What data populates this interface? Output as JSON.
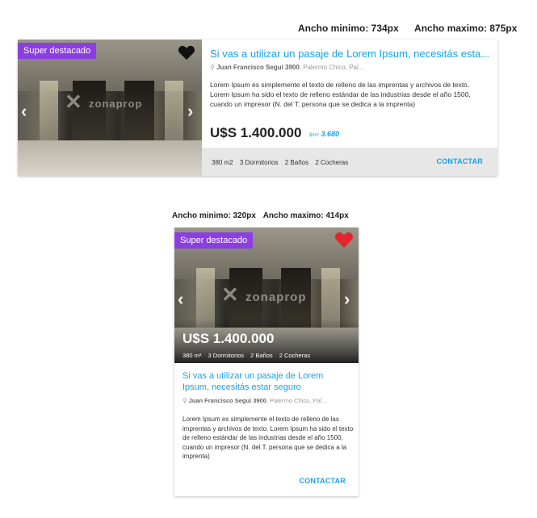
{
  "header_limits": {
    "wide_min": "Ancho minimo: 734px",
    "wide_max": "Ancho maximo: 875px",
    "narrow_min": "Ancho minimo: 320px",
    "narrow_max": "Ancho maximo: 414px"
  },
  "listing": {
    "badge": "Super destacado",
    "watermark": "zonaprop",
    "title_truncated": "Si vas a utilizar un pasaje de Lorem Ipsum, necesitás esta...",
    "title_full": "Si vas a utilizar un pasaje de Lorem Ipsum, necesitás estar seguro",
    "address_bold": "Juan Francisco Seguí 3900",
    "address_rest": ", Palermo Chico, Pal...",
    "description": "Lorem Ipsum es simplemente el texto de relleno de las imprentas y archivos de texto. Lorem Ipsum ha sido el texto de relleno estándar de las industrias desde el año 1500, cuando un impresor (N. del T. persona que se dedica a la imprenta)",
    "price": "U$S 1.400.000",
    "price_per_m2_unit": "$/m²",
    "price_per_m2_value": "3.680",
    "features": {
      "area_wide": "380 m2",
      "area_narrow": "380 m²",
      "bedrooms": "3 Dormitorios",
      "bathrooms": "2 Baños",
      "garages": "2 Cocheras"
    },
    "contact_label": "CONTACTAR"
  },
  "icons": {
    "location": "location-pin-icon",
    "heart": "heart-icon",
    "prev": "chevron-left-icon",
    "next": "chevron-right-icon"
  },
  "colors": {
    "badge": "#8b3fe0",
    "link": "#1aa0e6",
    "heart_wide": "#111111",
    "heart_narrow": "#e3262b",
    "footer_bg": "#e7e7e7"
  }
}
